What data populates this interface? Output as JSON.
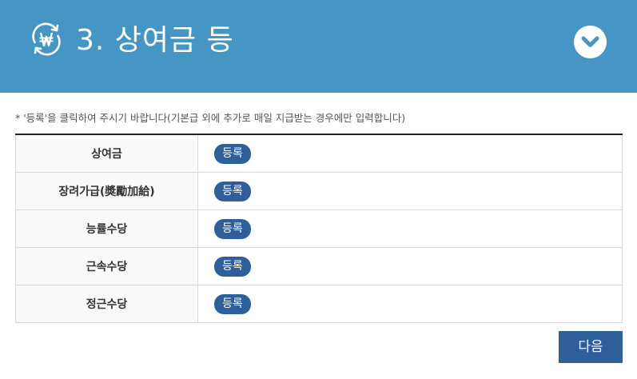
{
  "header": {
    "title": "3. 상여금 등",
    "icon": "won-cycle-icon",
    "toggle_icon": "chevron-down-icon",
    "background_color": "#4596c4"
  },
  "notice": "* '등록'을 클릭하여 주시기 바랍니다(기본급 외에 추가로 매일 지급받는 경우에만 입력합니다)",
  "table": {
    "rows": [
      {
        "label": "상여금",
        "button": "등록"
      },
      {
        "label": "장려가급(奬勵加給)",
        "button": "등록"
      },
      {
        "label": "능률수당",
        "button": "등록"
      },
      {
        "label": "근속수당",
        "button": "등록"
      },
      {
        "label": "정근수당",
        "button": "등록"
      }
    ]
  },
  "next_button": "다음",
  "button_color": "#2f5f9b"
}
